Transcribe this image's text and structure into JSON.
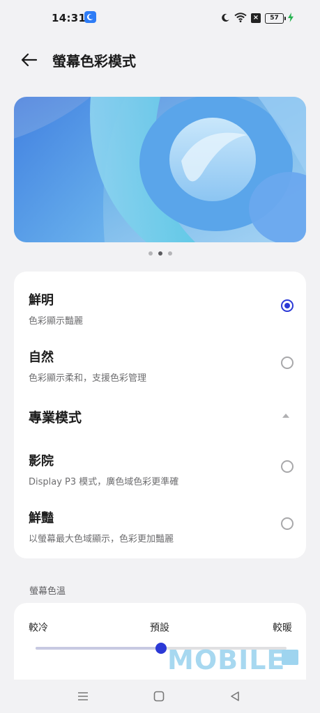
{
  "status_bar": {
    "time": "14:31",
    "icons": [
      "moon-badge-icon",
      "moon-icon",
      "wifi-icon",
      "no-sim-icon",
      "battery-icon",
      "charging-icon"
    ],
    "battery_level": "57"
  },
  "header": {
    "title": "螢幕色彩模式",
    "back_icon": "arrow-left-icon"
  },
  "preview": {
    "page_count": 3,
    "active_page": 2
  },
  "modes": [
    {
      "title": "鮮明",
      "subtitle": "色彩顯示豔麗",
      "selected": true
    },
    {
      "title": "自然",
      "subtitle": "色彩顯示柔和，支援色彩管理",
      "selected": false
    }
  ],
  "pro_section": {
    "title": "專業模式",
    "expanded": true,
    "items": [
      {
        "title": "影院",
        "subtitle": "Display P3 模式，廣色域色彩更準確",
        "selected": false
      },
      {
        "title": "鮮豔",
        "subtitle": "以螢幕最大色域顯示，色彩更加豔麗",
        "selected": false
      }
    ]
  },
  "temperature": {
    "caption": "螢幕色溫",
    "left_label": "較冷",
    "middle_label": "預設",
    "right_label": "較暖",
    "value_fraction": 0.5
  },
  "watermark": "MOBILE",
  "colors": {
    "accent": "#2b39d6",
    "background": "#f2f2f4",
    "card": "#ffffff"
  },
  "nav": {
    "icons": [
      "menu-icon",
      "home-square-icon",
      "back-triangle-icon"
    ]
  }
}
